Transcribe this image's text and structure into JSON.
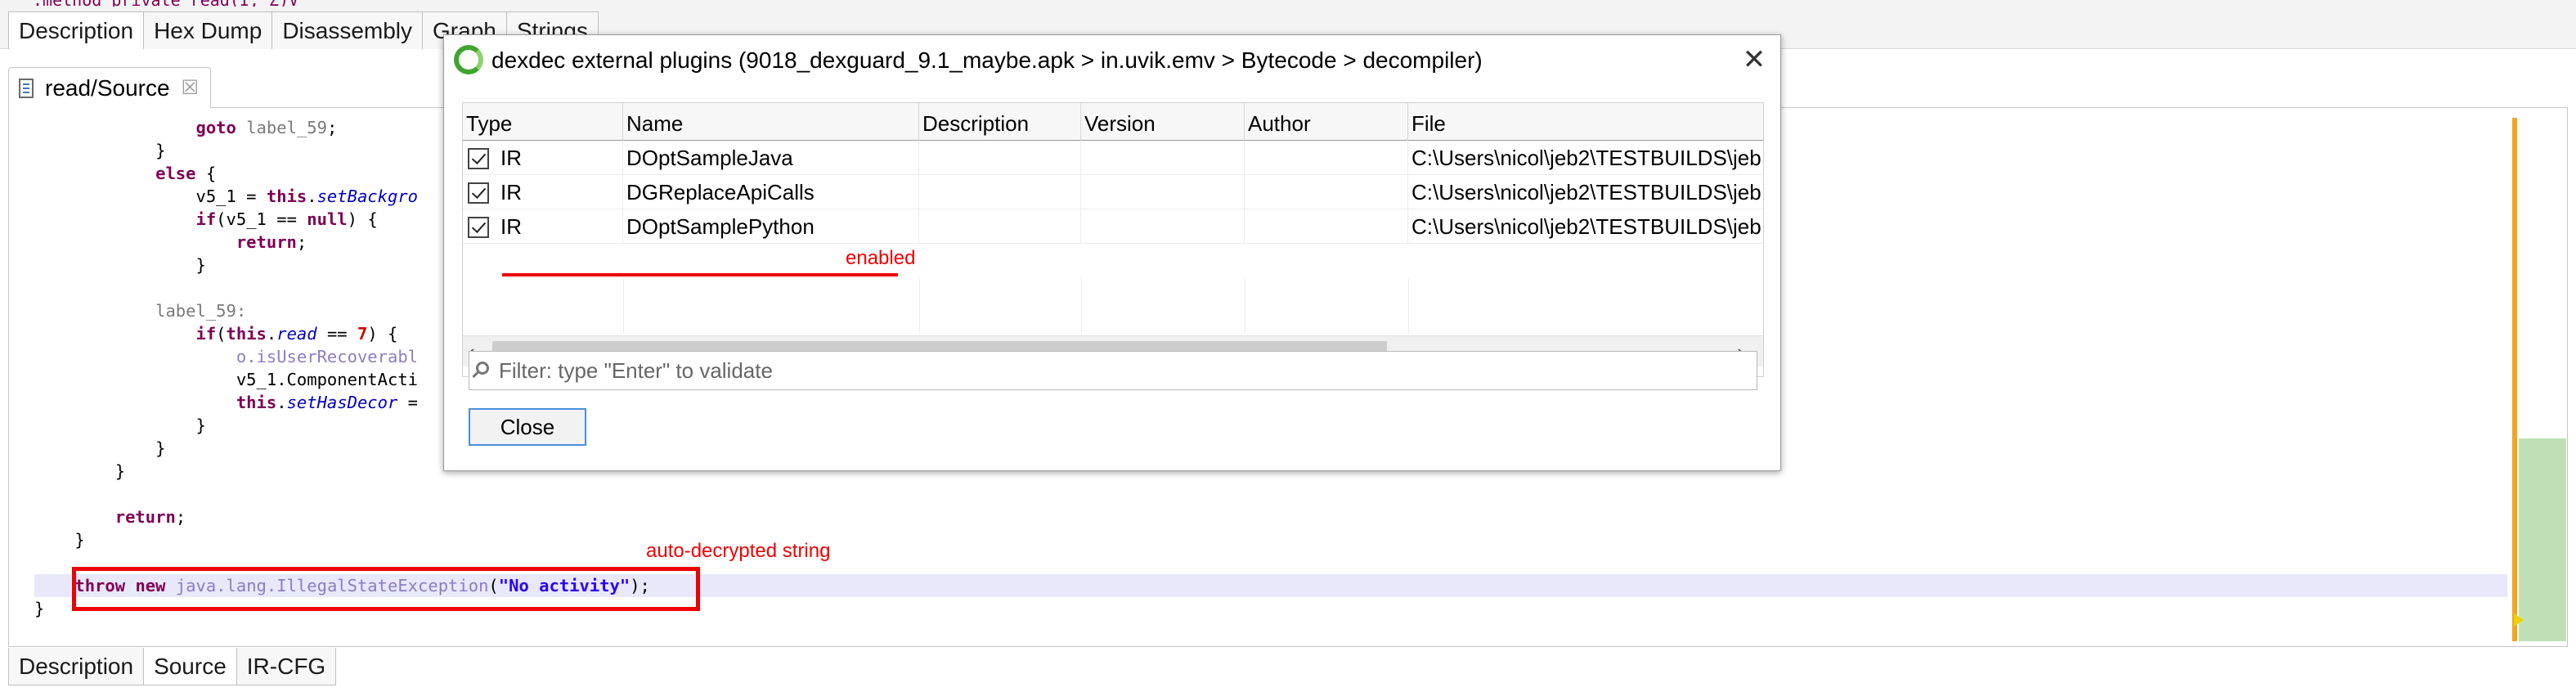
{
  "top_strip": {
    "code_line": "  .method private read(I, Z)V",
    "tabs": [
      "Description",
      "Hex Dump",
      "Disassembly",
      "Graph",
      "Strings"
    ]
  },
  "editor": {
    "tab_title": "read/Source",
    "tab_close": "☒"
  },
  "code": [
    [
      {
        "t": "                ",
        "c": ""
      },
      {
        "t": "goto",
        "c": "kw"
      },
      {
        "t": " ",
        "c": ""
      },
      {
        "t": "label_59",
        "c": "lbl"
      },
      {
        "t": ";",
        "c": ""
      }
    ],
    [
      {
        "t": "            }",
        "c": ""
      }
    ],
    [
      {
        "t": "            ",
        "c": ""
      },
      {
        "t": "else",
        "c": "kw"
      },
      {
        "t": " {",
        "c": ""
      }
    ],
    [
      {
        "t": "                v5_1 = ",
        "c": ""
      },
      {
        "t": "this",
        "c": "kw"
      },
      {
        "t": ".",
        "c": ""
      },
      {
        "t": "setBackgro",
        "c": "it"
      }
    ],
    [
      {
        "t": "                ",
        "c": ""
      },
      {
        "t": "if",
        "c": "kw"
      },
      {
        "t": "(v5_1 == ",
        "c": ""
      },
      {
        "t": "null",
        "c": "kw"
      },
      {
        "t": ") {",
        "c": ""
      }
    ],
    [
      {
        "t": "                    ",
        "c": ""
      },
      {
        "t": "return",
        "c": "kw"
      },
      {
        "t": ";",
        "c": ""
      }
    ],
    [
      {
        "t": "                }",
        "c": ""
      }
    ],
    [
      {
        "t": "",
        "c": ""
      }
    ],
    [
      {
        "t": "            ",
        "c": ""
      },
      {
        "t": "label_59:",
        "c": "lbl"
      }
    ],
    [
      {
        "t": "                ",
        "c": ""
      },
      {
        "t": "if",
        "c": "kw"
      },
      {
        "t": "(",
        "c": ""
      },
      {
        "t": "this",
        "c": "kw"
      },
      {
        "t": ".",
        "c": ""
      },
      {
        "t": "read",
        "c": "it"
      },
      {
        "t": " == ",
        "c": ""
      },
      {
        "t": "7",
        "c": "num"
      },
      {
        "t": ") {",
        "c": ""
      }
    ],
    [
      {
        "t": "                    ",
        "c": ""
      },
      {
        "t": "o.isUserRecoverabl",
        "c": "type"
      }
    ],
    [
      {
        "t": "                    v5_1.ComponentActi",
        "c": ""
      }
    ],
    [
      {
        "t": "                    ",
        "c": ""
      },
      {
        "t": "this",
        "c": "kw"
      },
      {
        "t": ".",
        "c": ""
      },
      {
        "t": "setHasDecor",
        "c": "it"
      },
      {
        "t": " =",
        "c": ""
      }
    ],
    [
      {
        "t": "                }",
        "c": ""
      }
    ],
    [
      {
        "t": "            }",
        "c": ""
      }
    ],
    [
      {
        "t": "        }",
        "c": ""
      }
    ],
    [
      {
        "t": "",
        "c": ""
      }
    ],
    [
      {
        "t": "        ",
        "c": ""
      },
      {
        "t": "return",
        "c": "kw"
      },
      {
        "t": ";",
        "c": ""
      }
    ],
    [
      {
        "t": "    }",
        "c": ""
      }
    ],
    [
      {
        "t": "",
        "c": ""
      }
    ],
    [
      {
        "t": "    ",
        "c": ""
      },
      {
        "t": "throw",
        "c": "kw"
      },
      {
        "t": " ",
        "c": ""
      },
      {
        "t": "new",
        "c": "kw"
      },
      {
        "t": " ",
        "c": ""
      },
      {
        "t": "java.lang.IllegalStateException",
        "c": "type"
      },
      {
        "t": "(",
        "c": ""
      },
      {
        "t": "\"No activity\"",
        "c": "str"
      },
      {
        "t": ");",
        "c": ""
      }
    ],
    [
      {
        "t": "}",
        "c": ""
      }
    ]
  ],
  "annotations": {
    "decrypted_label": "auto-decrypted string",
    "enabled_label": "enabled",
    "color": "#ee0000"
  },
  "bottom_tabs": [
    "Description",
    "Source",
    "IR-CFG"
  ],
  "dialog": {
    "title": "dexdec external plugins (9018_dexguard_9.1_maybe.apk > in.uvik.emv > Bytecode > decompiler)",
    "close_icon": "✕",
    "columns": [
      "Type",
      "Name",
      "Description",
      "Version",
      "Author",
      "File"
    ],
    "rows": [
      {
        "checked": true,
        "type": "IR",
        "name": "DOptSampleJava",
        "description": "",
        "version": "",
        "author": "",
        "file": "C:\\Users\\nicol\\jeb2\\TESTBUILDS\\jeb"
      },
      {
        "checked": true,
        "type": "IR",
        "name": "DGReplaceApiCalls",
        "description": "",
        "version": "",
        "author": "",
        "file": "C:\\Users\\nicol\\jeb2\\TESTBUILDS\\jeb"
      },
      {
        "checked": true,
        "type": "IR",
        "name": "DOptSamplePython",
        "description": "",
        "version": "",
        "author": "",
        "file": "C:\\Users\\nicol\\jeb2\\TESTBUILDS\\jeb"
      }
    ],
    "scroll_left": "‹",
    "scroll_right": "›",
    "filter_placeholder": "Filter: type \"Enter\" to validate",
    "filter_value": "",
    "close_button_label": "Close"
  }
}
